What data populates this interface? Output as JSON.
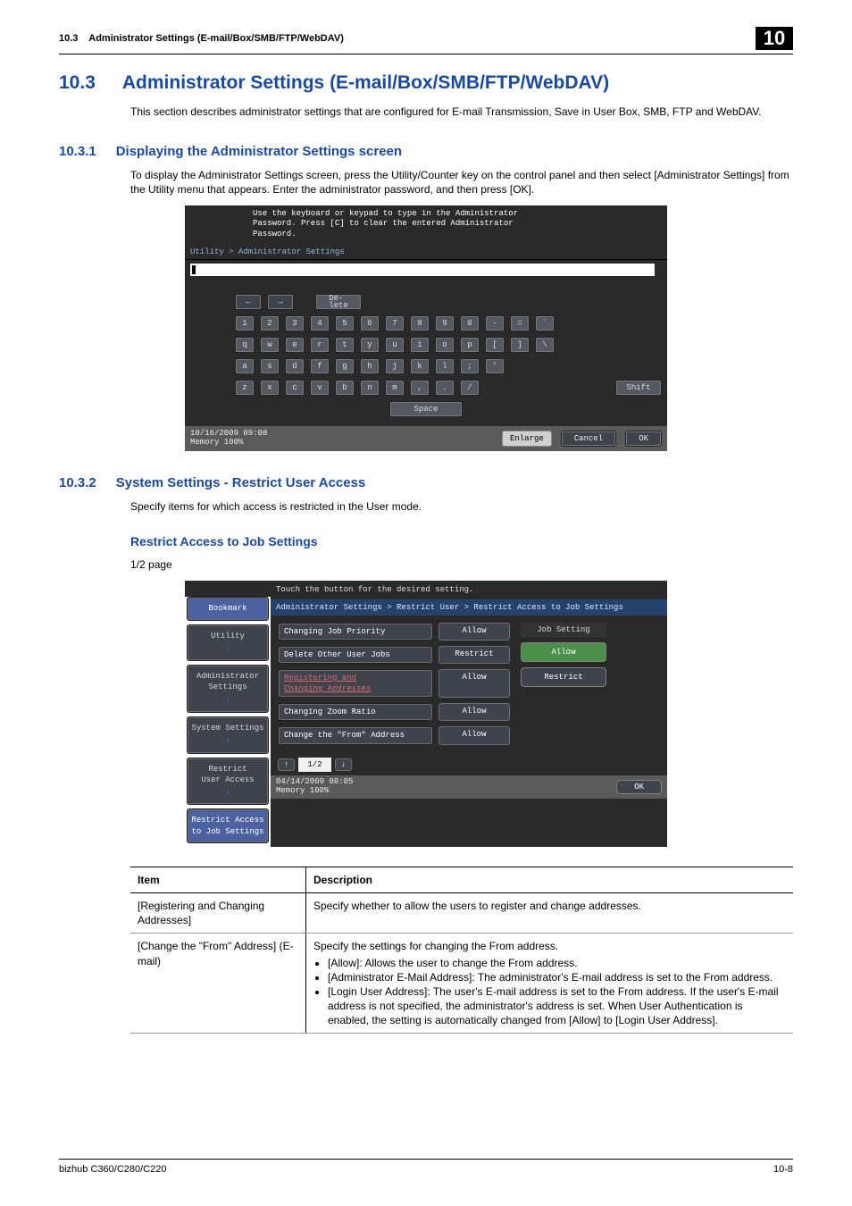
{
  "running_head": {
    "section_no": "10.3",
    "title": "Administrator Settings (E-mail/Box/SMB/FTP/WebDAV)",
    "chapter": "10"
  },
  "h1": {
    "num": "10.3",
    "title": "Administrator Settings (E-mail/Box/SMB/FTP/WebDAV)"
  },
  "intro": "This section describes administrator settings that are configured for E-mail Transmission, Save in User Box, SMB, FTP and WebDAV.",
  "h2a": {
    "num": "10.3.1",
    "title": "Displaying the Administrator Settings screen"
  },
  "p_a": "To display the Administrator Settings screen, press the Utility/Counter key on the control panel and then select [Administrator Settings] from the Utility menu that appears. Enter the administrator password, and then press [OK].",
  "panel1": {
    "hint": "Use the keyboard or keypad to type in the Administrator\nPassword.  Press [C] to clear the entered Administrator\nPassword.",
    "crumb": "Utility > Administrator Settings",
    "delete": "De-\nlete",
    "rows": {
      "r1": [
        "1",
        "2",
        "3",
        "4",
        "5",
        "6",
        "7",
        "8",
        "9",
        "0",
        "-",
        "=",
        "`"
      ],
      "r2": [
        "q",
        "w",
        "e",
        "r",
        "t",
        "y",
        "u",
        "i",
        "o",
        "p",
        "[",
        "]",
        "\\"
      ],
      "r3": [
        "a",
        "s",
        "d",
        "f",
        "g",
        "h",
        "j",
        "k",
        "l",
        ";",
        "'"
      ],
      "r4": [
        "z",
        "x",
        "c",
        "v",
        "b",
        "n",
        "m",
        ",",
        ".",
        "/"
      ]
    },
    "shift": "Shift",
    "space": "Space",
    "datetime": "10/16/2009   09:08\nMemory      100%",
    "enlarge": "Enlarge",
    "cancel": "Cancel",
    "ok": "OK"
  },
  "h2b": {
    "num": "10.3.2",
    "title": "System Settings - Restrict User Access"
  },
  "p_b": "Specify items for which access is restricted in the User mode.",
  "h3": "Restrict Access to Job Settings",
  "p_c": "1/2 page",
  "panel2": {
    "hint": "Touch the button for the desired setting.",
    "crumb": "Administrator Settings > Restrict User > Restrict Access to Job Settings",
    "side": [
      "Bookmark",
      "Utility",
      "Administrator\nSettings",
      "System Settings",
      "Restrict\nUser Access",
      "Restrict Access\nto Job Settings"
    ],
    "rows": [
      {
        "label": "Changing Job Priority",
        "val": "Allow"
      },
      {
        "label": "Delete Other User Jobs",
        "val": "Restrict"
      },
      {
        "label": "Registering and\nChanging Addresses",
        "val": "Allow",
        "red": true
      },
      {
        "label": "Changing Zoom Ratio",
        "val": "Allow"
      },
      {
        "label": "Change the \"From\" Address",
        "val": "Allow"
      }
    ],
    "right_title": "Job Setting",
    "allow": "Allow",
    "restrict": "Restrict",
    "pager": "1/2",
    "datetime": "04/14/2009   08:05\nMemory      100%",
    "ok": "OK"
  },
  "table": {
    "h_item": "Item",
    "h_desc": "Description",
    "r1_item": "[Registering and Changing Addresses]",
    "r1_desc": "Specify whether to allow the users to register and change addresses.",
    "r2_item": "[Change the \"From\" Address] (E-mail)",
    "r2_desc_lead": "Specify the settings for changing the From address.",
    "r2_b1": "[Allow]: Allows the user to change the From address.",
    "r2_b2": "[Administrator E-Mail Address]: The administrator's E-mail address is set to the From address.",
    "r2_b3": "[Login User Address]: The user's E-mail address is set to the From address. If the user's E-mail address is not specified, the administrator's address is set. When User Authentication is enabled, the setting is automatically changed from [Allow] to [Login User Address]."
  },
  "footer": {
    "left": "bizhub C360/C280/C220",
    "right": "10-8"
  }
}
